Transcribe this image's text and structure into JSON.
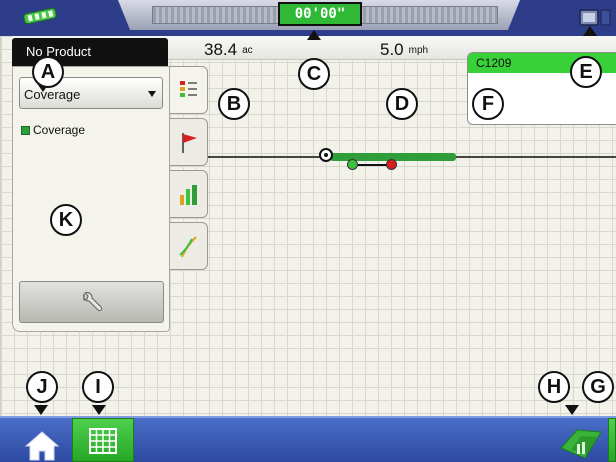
{
  "top_bar": {
    "timer": "00'00\"",
    "gps_icon": "satellite-signal-icon",
    "screen_icon": "display-settings-icon"
  },
  "product": {
    "name": "No Product"
  },
  "stats": {
    "area_value": "38.4",
    "area_unit": "ac",
    "speed_value": "5.0",
    "speed_unit": "mph"
  },
  "legend": {
    "selected": "Coverage",
    "items": [
      {
        "label": "Coverage",
        "color": "#2f9e3a"
      }
    ],
    "settings_icon": "wrench-icon"
  },
  "side_tabs": [
    {
      "name": "legend-tab",
      "icon": "legend-list-icon"
    },
    {
      "name": "flags-tab",
      "icon": "red-flag-icon"
    },
    {
      "name": "summary-tab",
      "icon": "bar-chart-icon"
    },
    {
      "name": "guidance-tab",
      "icon": "guidance-path-icon"
    }
  ],
  "field": {
    "name": "C1209",
    "accent": "#39d139"
  },
  "callouts": [
    "A",
    "B",
    "C",
    "D",
    "E",
    "F",
    "G",
    "H",
    "I",
    "J",
    "K"
  ],
  "colors": {
    "top_bar": "#2d3d8a",
    "bottom_bar": "#2d4aa0",
    "active_green": "#2fb934",
    "coverage_green": "#2f9e3a"
  },
  "bottom_bar": {
    "home_icon": "home-icon",
    "grid_icon": "grid-view-icon",
    "field_tools_icon": "field-operations-icon"
  }
}
